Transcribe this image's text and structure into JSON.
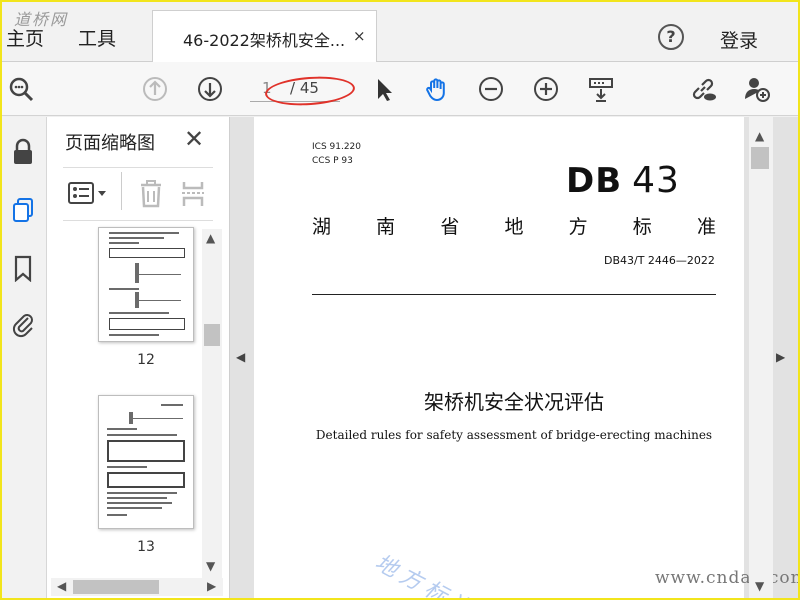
{
  "menu": {
    "home": "主页",
    "tools": "工具",
    "login": "登录",
    "watermark": "道桥网"
  },
  "tab": {
    "title": "46-2022架桥机安全...",
    "close": "×"
  },
  "toolbar": {
    "page_current": "1",
    "page_total": "/ 45",
    "icons": [
      "zoom-search-icon",
      "arrow-up-icon",
      "arrow-down-icon",
      "select-arrow-icon",
      "hand-icon",
      "zoom-out-icon",
      "zoom-in-icon",
      "scroll-mode-icon",
      "share-link-icon",
      "add-user-icon"
    ]
  },
  "rail": {
    "icons": [
      "lock-icon",
      "pages-icon",
      "bookmark-icon",
      "attachment-icon"
    ]
  },
  "thumbnails": {
    "title": "页面缩略图",
    "close": "✕",
    "pages": [
      {
        "label": "12"
      },
      {
        "label": "13"
      }
    ]
  },
  "document": {
    "ics": "ICS 91.220",
    "ccs": "CCS P 93",
    "db_logo": "DB",
    "db_number": "43",
    "standard_title_chars": [
      "湖",
      "南",
      "省",
      "地",
      "方",
      "标",
      "准"
    ],
    "standard_number": "DB43/T 2446—2022",
    "title_cn": "架桥机安全状况评估",
    "title_en": "Detailed rules for safety assessment of bridge-erecting machines",
    "watermark": "地方标准",
    "site": "www.cndao.com"
  },
  "colors": {
    "accent_blue": "#1473e6",
    "annotation_red": "#e0322a",
    "frame_yellow": "#f2e51c"
  }
}
